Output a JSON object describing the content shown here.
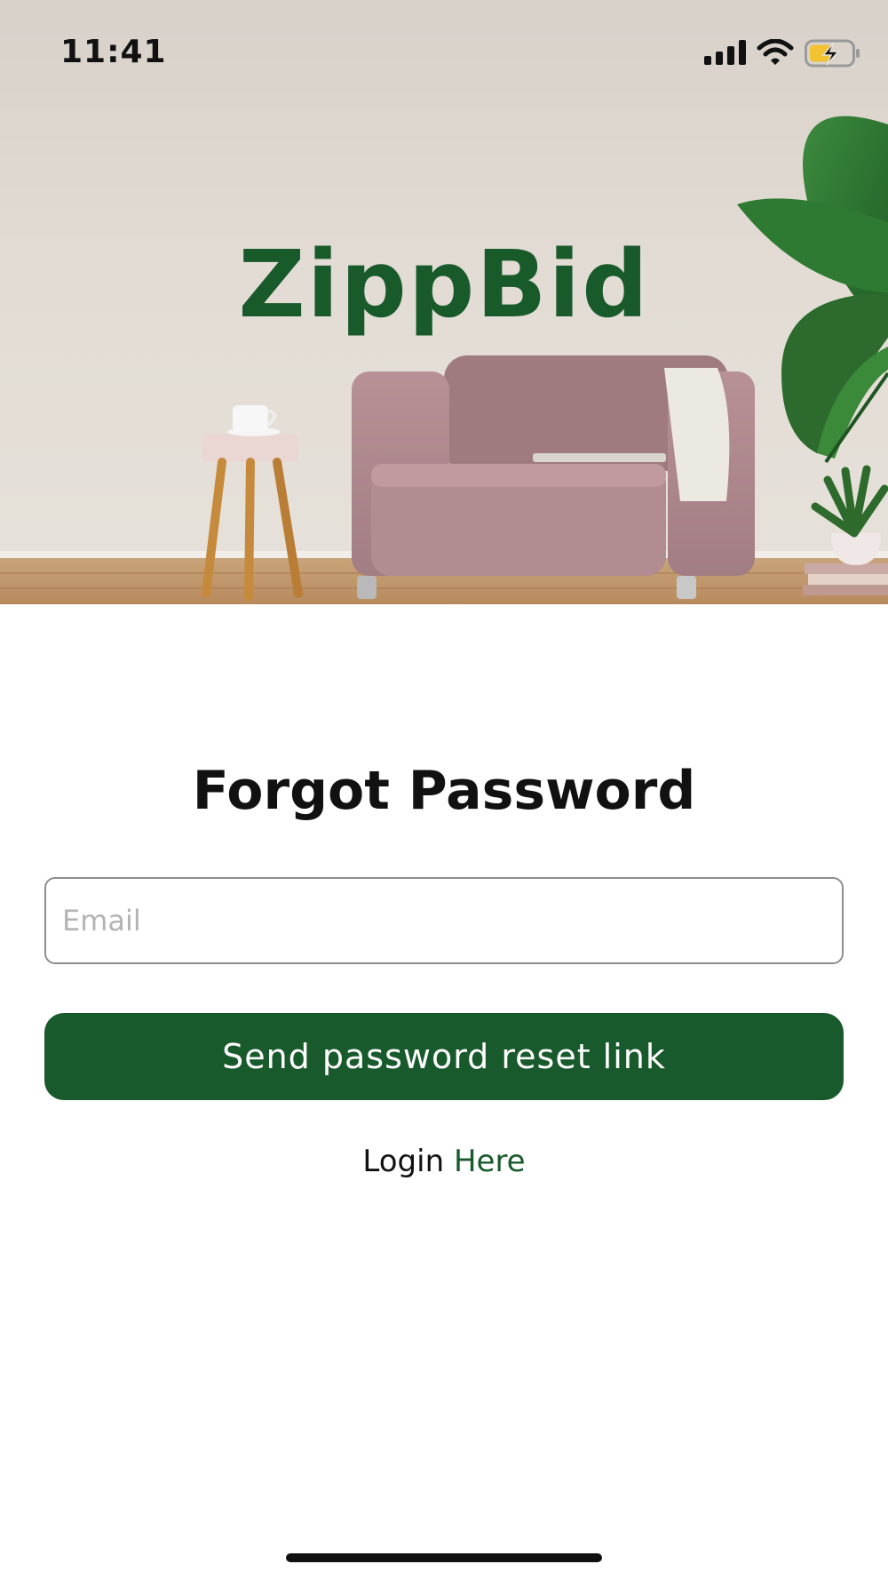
{
  "status_bar": {
    "time": "11:41",
    "icons": [
      "signal-icon",
      "wifi-icon",
      "battery-charging-icon"
    ]
  },
  "hero": {
    "brand": "ZippBid",
    "image": "living-room-armchair-plant-photo"
  },
  "form": {
    "title": "Forgot Password",
    "email_placeholder": "Email",
    "email_value": "",
    "submit_label": "Send password reset link",
    "login_prefix": "Login",
    "login_link": "Here"
  },
  "colors": {
    "brand_green": "#185a2c",
    "text": "#111111",
    "placeholder": "#b3b3b3",
    "field_border": "#8d8d8d"
  }
}
